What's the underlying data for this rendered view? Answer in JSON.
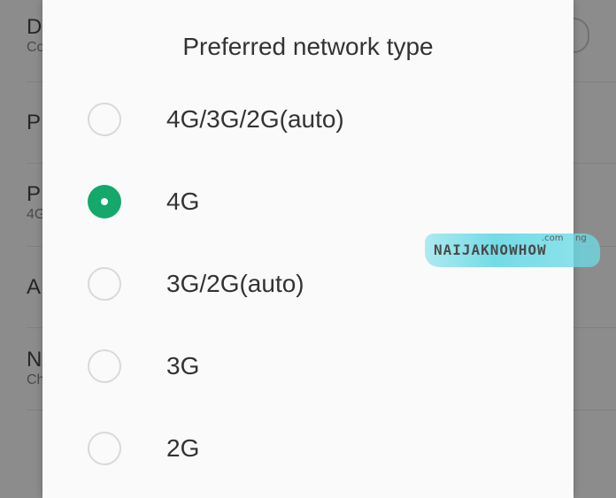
{
  "background_list": {
    "rows": [
      {
        "title": "D",
        "subtitle": "Co"
      },
      {
        "title": "P",
        "subtitle": ""
      },
      {
        "title": "P",
        "subtitle": "4G"
      },
      {
        "title": "A",
        "subtitle": ""
      },
      {
        "title": "N",
        "subtitle": "Ch"
      }
    ]
  },
  "dialog": {
    "title": "Preferred network type",
    "options": [
      {
        "label": "4G/3G/2G(auto)",
        "checked": false
      },
      {
        "label": "4G",
        "checked": true
      },
      {
        "label": "3G/2G(auto)",
        "checked": false
      },
      {
        "label": "3G",
        "checked": false
      },
      {
        "label": "2G",
        "checked": false
      }
    ]
  },
  "watermark": {
    "text": "NAIJAKNOWHOW",
    "sup": ".com",
    "sup2": "ng"
  },
  "colors": {
    "accent": "#14a86b",
    "dialog_bg": "#fafafa",
    "scrim": "#8c8c8c",
    "text": "#333333",
    "watermark": "#5bd6e3"
  },
  "icons": {
    "radio_checked": "radio-checked-icon",
    "radio_unchecked": "radio-unchecked-icon"
  }
}
